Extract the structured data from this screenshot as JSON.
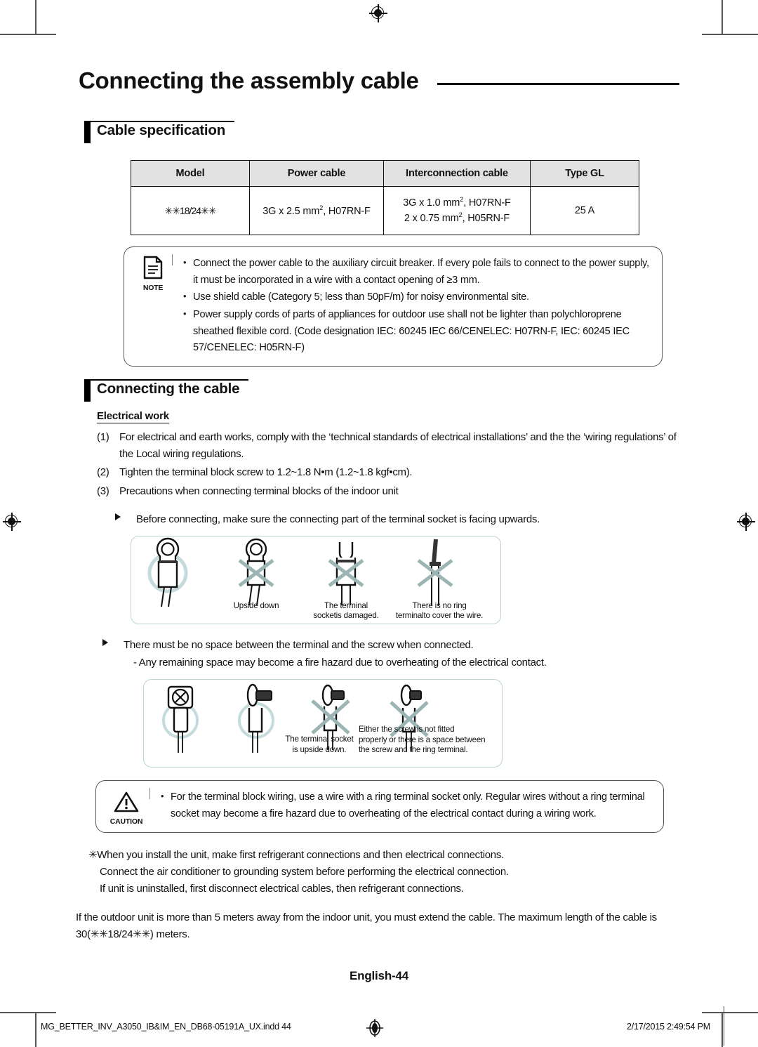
{
  "chapter": {
    "title": "Connecting the assembly cable"
  },
  "sections": {
    "cable_spec": "Cable specification",
    "connecting": "Connecting the cable"
  },
  "spec_table": {
    "headers": [
      "Model",
      "Power cable",
      "Interconnection cable",
      "Type GL"
    ],
    "rows": [
      {
        "model": "✳✳18/24✳✳",
        "power_cable_pre": "3G x 2.5 mm",
        "power_cable_sup": "2",
        "power_cable_post": ", H07RN-F",
        "inter_line1_pre": "3G x 1.0 mm",
        "inter_line1_sup": "2",
        "inter_line1_post": ", H07RN-F",
        "inter_line2_pre": "2 x 0.75 mm",
        "inter_line2_sup": "2",
        "inter_line2_post": ", H05RN-F",
        "type_gl": "25 A"
      }
    ]
  },
  "note_box": {
    "icon_label": "NOTE",
    "items": [
      "Connect the power cable to the auxiliary circuit breaker. If every pole fails to connect to the power supply, it must be incorporated in a wire with a contact opening of ≥3 mm.",
      "Use shield cable (Category 5; less than 50pF/m) for noisy environmental site.",
      "Power supply cords of parts of appliances for outdoor use shall not be lighter than polychloroprene sheathed flexible cord. (Code designation IEC: 60245 IEC 66/CENELEC: H07RN-F, IEC: 60245 IEC 57/CENELEC: H05RN-F)"
    ]
  },
  "electrical_work": {
    "heading": "Electrical work",
    "items": [
      {
        "num": "(1)",
        "text": "For electrical and earth works, comply with the ‘technical standards of electrical installations’ and the the ‘wiring regulations’ of the Local wiring regulations."
      },
      {
        "num": "(2)",
        "text": "Tighten the terminal block screw to 1.2~1.8 N•m (1.2~1.8 kgf•cm)."
      },
      {
        "num": "(3)",
        "text": "Precautions when connecting terminal blocks of the indoor unit"
      }
    ]
  },
  "figure1": {
    "lead": "Before connecting, make sure the connecting part of the terminal socket is facing upwards.",
    "captions": [
      {
        "lines": [
          "Upside down"
        ]
      },
      {
        "lines": [
          "The terminal",
          "socketis damaged."
        ]
      },
      {
        "lines": [
          "There is no ring",
          "terminalto cover the wire."
        ]
      }
    ]
  },
  "figure2": {
    "lead": "There must be no space between the terminal and the screw when connected.",
    "sub": "- Any remaining space may become a fire hazard due to overheating of the electrical contact.",
    "captions": [
      {
        "lines": [
          "The terminal socket",
          "is upside down."
        ]
      },
      {
        "lines": [
          "Either the screw is not fitted",
          "properly or there is a space between",
          "the screw and the ring terminal."
        ]
      }
    ]
  },
  "caution_box": {
    "icon_label": "CAUTION",
    "items": [
      "For the terminal block wiring, use a wire with a ring terminal socket only. Regular wires without a ring terminal socket may become a fire hazard due to overheating of the electrical contact during a wiring work."
    ]
  },
  "closing": {
    "lines": [
      "✳When you install the unit, make first refrigerant connections and then electrical connections.",
      "Connect the air conditioner to grounding system before performing the electrical connection.",
      "If unit is uninstalled, first disconnect electrical cables, then refrigerant connections."
    ],
    "paragraph": "If the outdoor unit is more than 5 meters away from the indoor unit, you must extend the cable. The maximum length of the cable is 30(✳✳18/24✳✳) meters."
  },
  "page_number": "English-44",
  "footer": {
    "file": "MG_BETTER_INV_A3050_IB&IM_EN_DB68-05191A_UX.indd   44",
    "timestamp": "2/17/2015   2:49:54 PM"
  },
  "colors": {
    "figure_border": "#bcd4d4",
    "x_mark": "#9bb5b5",
    "highlight_circle": "#c5dada",
    "table_header_bg": "#e2e2e2"
  }
}
